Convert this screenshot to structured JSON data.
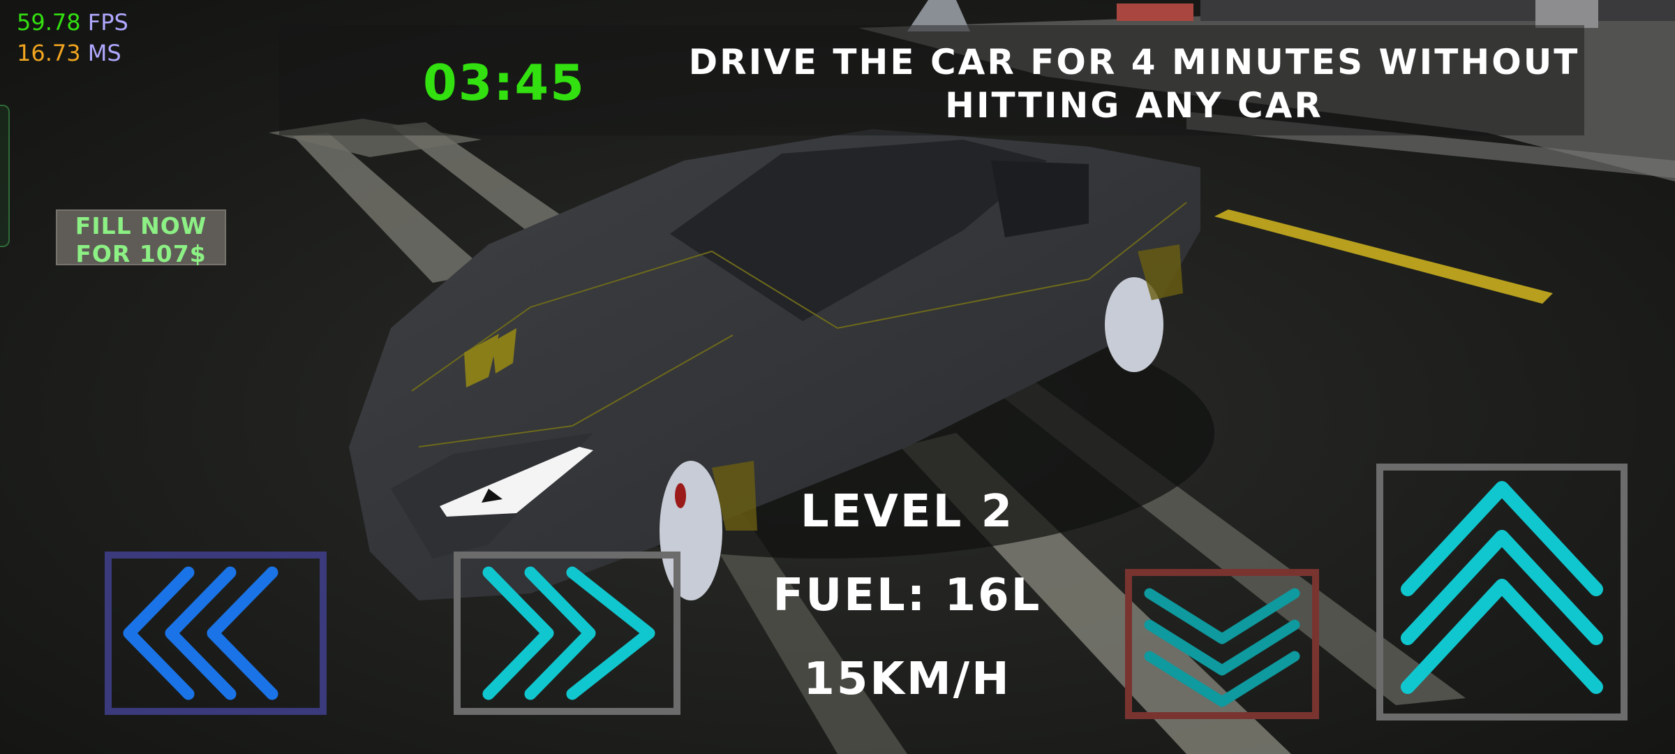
{
  "stats": {
    "fps_value": "59.78",
    "fps_label": "FPS",
    "ms_value": "16.73",
    "ms_label": "MS"
  },
  "hud": {
    "timer": "03:45",
    "objective_line1": "DRIVE THE CAR FOR 4 MINUTES WITHOUT",
    "objective_line2": "HITTING ANY CAR",
    "fill_line1": "FILL NOW",
    "fill_line2": "FOR 107$",
    "level": "LEVEL 2",
    "fuel": "FUEL: 16L",
    "speed": "15KM/H"
  },
  "controls": {
    "steer_left": "left-arrows-icon",
    "steer_right": "right-arrows-icon",
    "brake": "down-arrows-icon",
    "accelerate": "up-arrows-icon"
  },
  "colors": {
    "timer": "#33e010",
    "fps": "#33e010",
    "ms": "#f2a51f",
    "stat_label": "#b0a8ff",
    "fill_text": "#8cf084",
    "left_arrows": "#1a74e8",
    "cyan_arrows": "#11c7cf",
    "brake_arrows": "#0e9a9e"
  }
}
